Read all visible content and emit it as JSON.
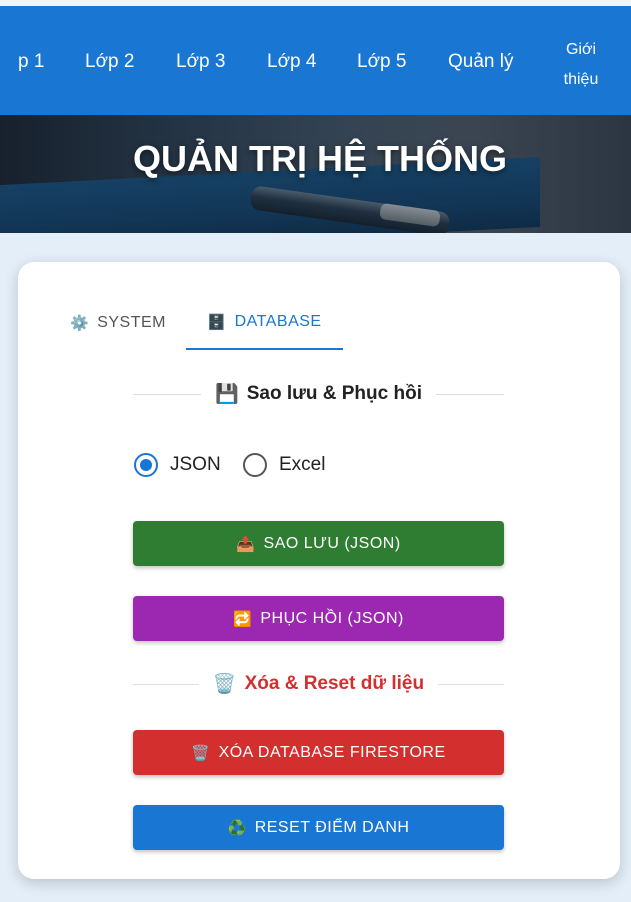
{
  "nav": {
    "items": [
      {
        "label": "p 1"
      },
      {
        "label": "Lớp 2"
      },
      {
        "label": "Lớp 3"
      },
      {
        "label": "Lớp 4"
      },
      {
        "label": "Lớp 5"
      },
      {
        "label": "Quản lý"
      },
      {
        "label": "Giới thiệu",
        "line1": "Giới",
        "line2": "thiệu"
      }
    ]
  },
  "hero": {
    "title": "QUẢN TRỊ HỆ THỐNG"
  },
  "tabs": [
    {
      "icon": "gear-icon",
      "glyph": "⚙️",
      "label": "SYSTEM",
      "active": false
    },
    {
      "icon": "file-cabinet-icon",
      "glyph": "🗄️",
      "label": "DATABASE",
      "active": true
    }
  ],
  "backup_section": {
    "icon": "floppy-disk-icon",
    "glyph": "💾",
    "title": "Sao lưu & Phục hồi"
  },
  "format_options": {
    "selected": "JSON",
    "options": [
      "JSON",
      "Excel"
    ]
  },
  "buttons": {
    "backup": {
      "icon": "outbox-tray-icon",
      "glyph": "📤",
      "label": "SAO LƯU (JSON)",
      "color": "#2e7d32"
    },
    "restore": {
      "icon": "repeat-arrows-icon",
      "glyph": "🔁",
      "label": "PHỤC HỒI (JSON)",
      "color": "#9c27b0"
    },
    "delete_db": {
      "icon": "wastebasket-icon",
      "glyph": "🗑️",
      "label": "XÓA DATABASE FIRESTORE",
      "color": "#d32f2f"
    },
    "reset_attendance": {
      "icon": "recycle-icon",
      "glyph": "♻️",
      "label": "RESET ĐIỂM DANH",
      "color": "#1976d2"
    }
  },
  "reset_section": {
    "icon": "wastebasket-icon",
    "glyph": "🗑️",
    "title": "Xóa & Reset dữ liệu",
    "color": "#d32f2f"
  },
  "colors": {
    "primary": "#1976d2",
    "background": "#e3eef8"
  }
}
